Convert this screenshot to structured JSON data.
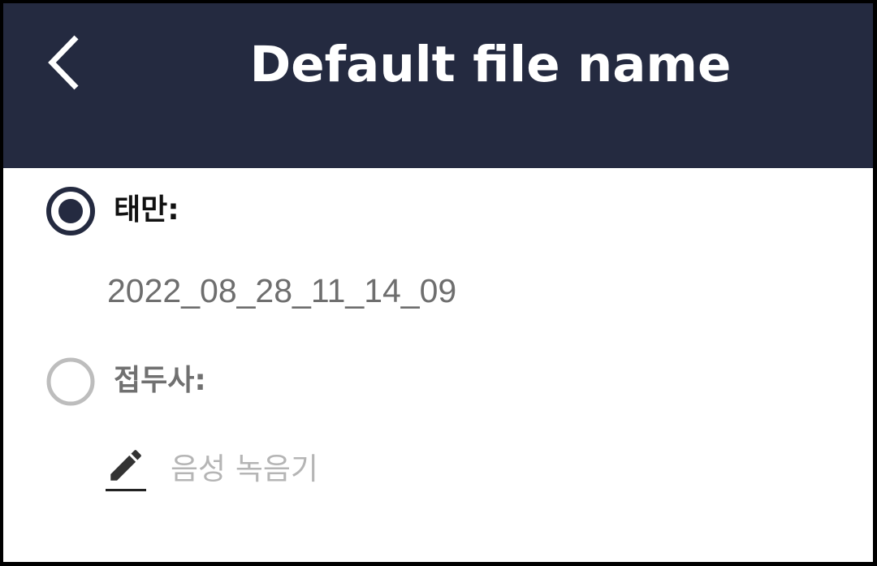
{
  "header": {
    "title": "Default file name",
    "back_icon": "chevron-left-icon",
    "background": "#242a40"
  },
  "options": {
    "default": {
      "label": "태만:",
      "selected": true,
      "value": "2022_08_28_11_14_09"
    },
    "prefix": {
      "label": "접두사:",
      "selected": false,
      "placeholder": "음성 녹음기",
      "edit_icon": "pencil-icon"
    }
  },
  "colors": {
    "accent": "#242a40",
    "radio_inactive": "#bdbdbd"
  }
}
